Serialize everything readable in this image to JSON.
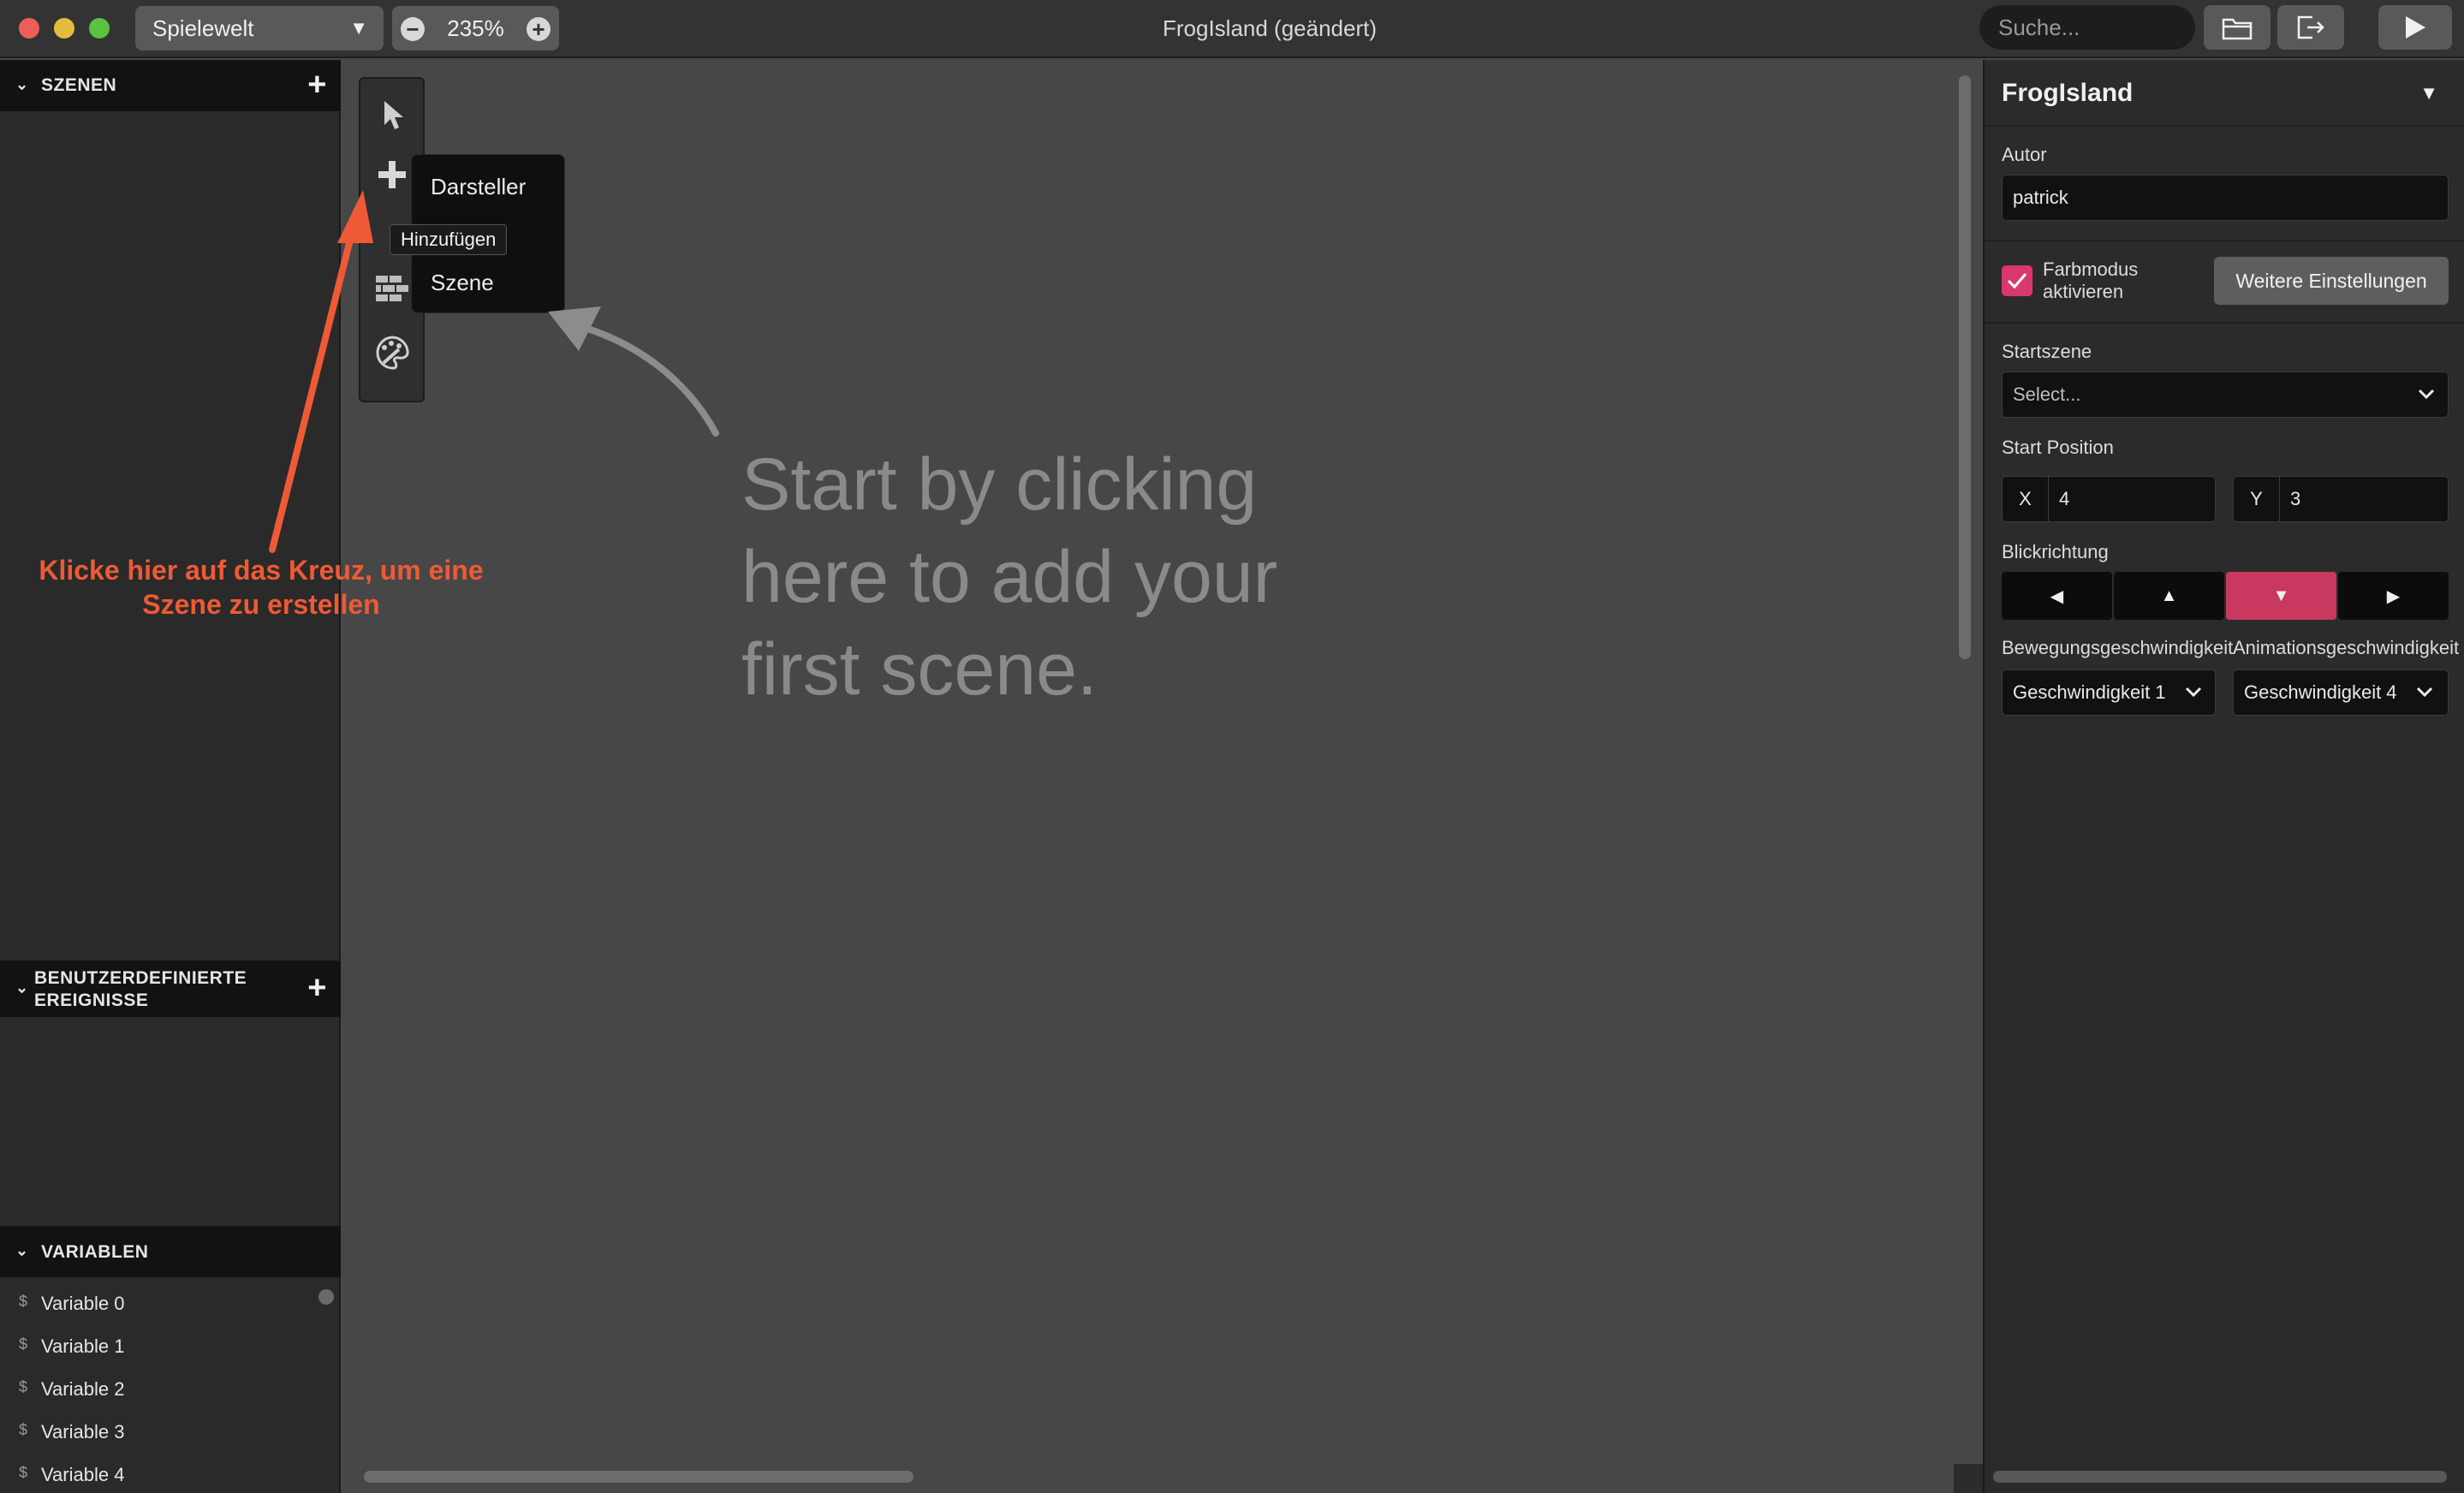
{
  "window": {
    "title": "FrogIsland (geändert)"
  },
  "toolbar": {
    "project_select": "Spielewelt",
    "zoom_value": "235%",
    "search_placeholder": "Suche..."
  },
  "sidebar": {
    "scenes_header": "SZENEN",
    "events_header": "BENUTZERDEFINIERTE EREIGNISSE",
    "variables_header": "VARIABLEN",
    "variables": [
      {
        "symbol": "$",
        "name": "Variable 0"
      },
      {
        "symbol": "$",
        "name": "Variable 1"
      },
      {
        "symbol": "$",
        "name": "Variable 2"
      },
      {
        "symbol": "$",
        "name": "Variable 3"
      },
      {
        "symbol": "$",
        "name": "Variable 4"
      }
    ]
  },
  "canvas": {
    "add_menu": {
      "items": [
        "Darsteller",
        "Szene"
      ],
      "tooltip": "Hinzufügen"
    },
    "hint_text": "Start by clicking here to add your first scene.",
    "annotation": "Klicke hier auf das Kreuz, um eine Szene zu erstellen"
  },
  "properties": {
    "title": "FrogIsland",
    "author_label": "Autor",
    "author_value": "patrick",
    "color_mode_label": "Farbmodus aktivieren",
    "color_mode_checked": true,
    "more_settings": "Weitere Einstellungen",
    "start_scene_label": "Startszene",
    "start_scene_placeholder": "Select...",
    "start_position_label": "Start Position",
    "x_label": "X",
    "x_value": "4",
    "y_label": "Y",
    "y_value": "3",
    "direction_label": "Blickrichtung",
    "direction_options": [
      "left",
      "up",
      "down",
      "right"
    ],
    "direction_selected": "down",
    "move_speed_label": "Bewegungsgeschwindigkeit",
    "move_speed_value": "Geschwindigkeit 1",
    "anim_speed_label": "Animationsgeschwindigkeit",
    "anim_speed_value": "Geschwindigkeit 4"
  },
  "colors": {
    "accent": "#c8385f",
    "annotation": "#ee5a35"
  }
}
